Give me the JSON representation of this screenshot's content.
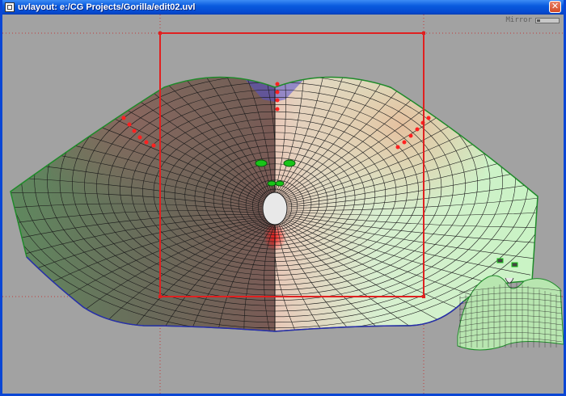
{
  "window": {
    "title": "uvlayout: e:/CG Projects/Gorilla/edit02.uvl",
    "close_glyph": "✕",
    "app_icon": "uvlayout-icon"
  },
  "toolbar": {
    "mirror_label": "Mirror",
    "mirror_enabled": false
  },
  "colors": {
    "background": "#a2a2a2",
    "grid_line": "#c03a3a",
    "uv_box": "#e02020",
    "left_half": "#5c7e5c",
    "right_half": "#c8f2c0",
    "mesh_edge": "#1a1a1a",
    "border_edge": "#1f8a2a",
    "seam_points": "#ff2020",
    "selection": "#3030d0",
    "eye_islands": "#19c419"
  }
}
